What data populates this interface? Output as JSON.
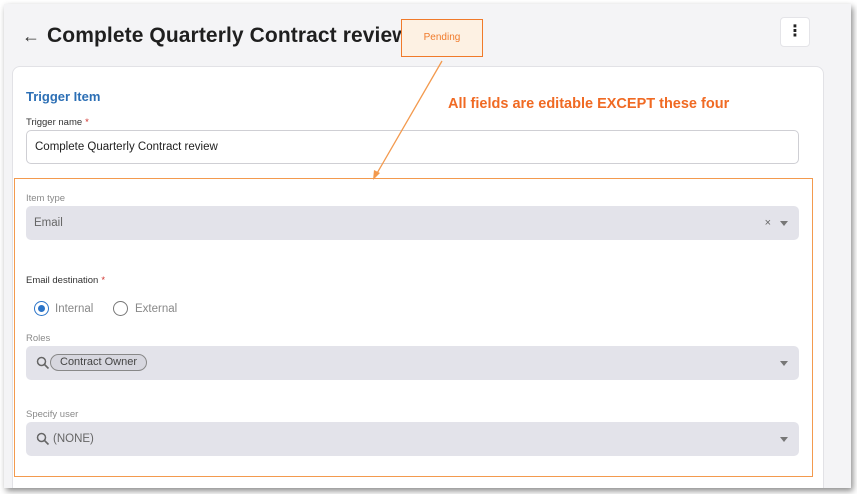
{
  "header": {
    "title": "Complete Quarterly Contract review",
    "status_badge": "Pending",
    "back_icon": "arrow-left-icon",
    "more_icon": "more-vertical-icon"
  },
  "form": {
    "section_title": "Trigger Item",
    "trigger_name_label": "Trigger name",
    "required_mark": "*",
    "trigger_name_value": "Complete Quarterly Contract review",
    "item_type_label": "Item type",
    "item_type_value": "Email",
    "clear_glyph": "×",
    "email_destination_label": "Email destination",
    "email_destination_options": [
      "Internal",
      "External"
    ],
    "email_destination_selected": "Internal",
    "roles_label": "Roles",
    "roles_chip": "Contract Owner",
    "specify_user_label": "Specify user",
    "specify_user_value": "(NONE)"
  },
  "annotation": {
    "text": "All fields are editable EXCEPT these four",
    "color": "#f06a23"
  },
  "colors": {
    "accent": "#2b74c8",
    "section_title": "#2c6fb5",
    "annotation_orange": "#f39a4e",
    "disabled_field": "#e3e3ea"
  }
}
